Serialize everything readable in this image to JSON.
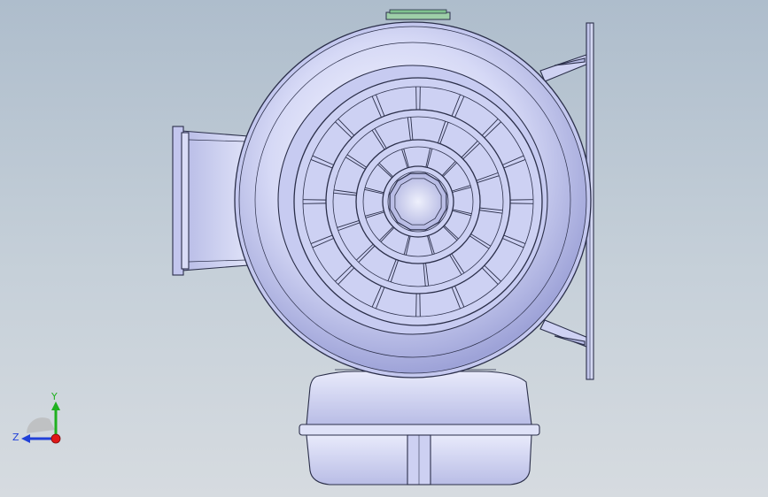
{
  "viewport": {
    "background_top": "#aebdcc",
    "background_bottom": "#d6dbe0"
  },
  "model": {
    "name": "",
    "body_color": "#c9cdf2",
    "edge_color": "#2b2f4a",
    "highlight_color": "#e4e7fb"
  },
  "triad": {
    "x_color": "#e01818",
    "y_color": "#20b020",
    "z_color": "#2040d8",
    "y_label": "Y",
    "z_label": "Z"
  }
}
